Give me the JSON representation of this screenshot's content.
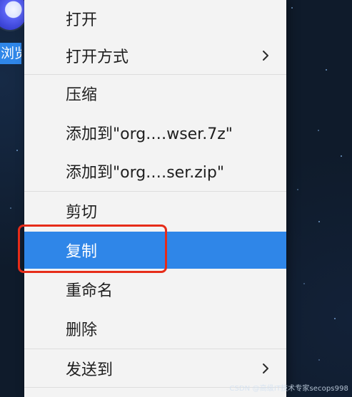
{
  "desktop": {
    "app_label_partial": "浏览"
  },
  "context_menu": {
    "items": [
      {
        "label": "打开",
        "has_submenu": false,
        "selected": false
      },
      {
        "label": "打开方式",
        "has_submenu": true,
        "selected": false
      },
      {
        "label": "压缩",
        "has_submenu": false,
        "selected": false
      },
      {
        "label": "添加到\"org.…wser.7z\"",
        "has_submenu": false,
        "selected": false
      },
      {
        "label": "添加到\"org.…ser.zip\"",
        "has_submenu": false,
        "selected": false
      },
      {
        "label": "剪切",
        "has_submenu": false,
        "selected": false
      },
      {
        "label": "复制",
        "has_submenu": false,
        "selected": true
      },
      {
        "label": "重命名",
        "has_submenu": false,
        "selected": false
      },
      {
        "label": "删除",
        "has_submenu": false,
        "selected": false
      },
      {
        "label": "发送到",
        "has_submenu": true,
        "selected": false
      }
    ]
  },
  "watermark": {
    "text": "CSDN @高级IT技术专家secops998"
  },
  "colors": {
    "menu_background": "#f3f3f3",
    "selected_background": "#2f86e8",
    "highlight_border": "#e62c19",
    "desktop_background": "#0f1b2b"
  },
  "icons": {
    "submenu": "chevron-right-icon",
    "desktop_app": "browser-app-icon"
  }
}
